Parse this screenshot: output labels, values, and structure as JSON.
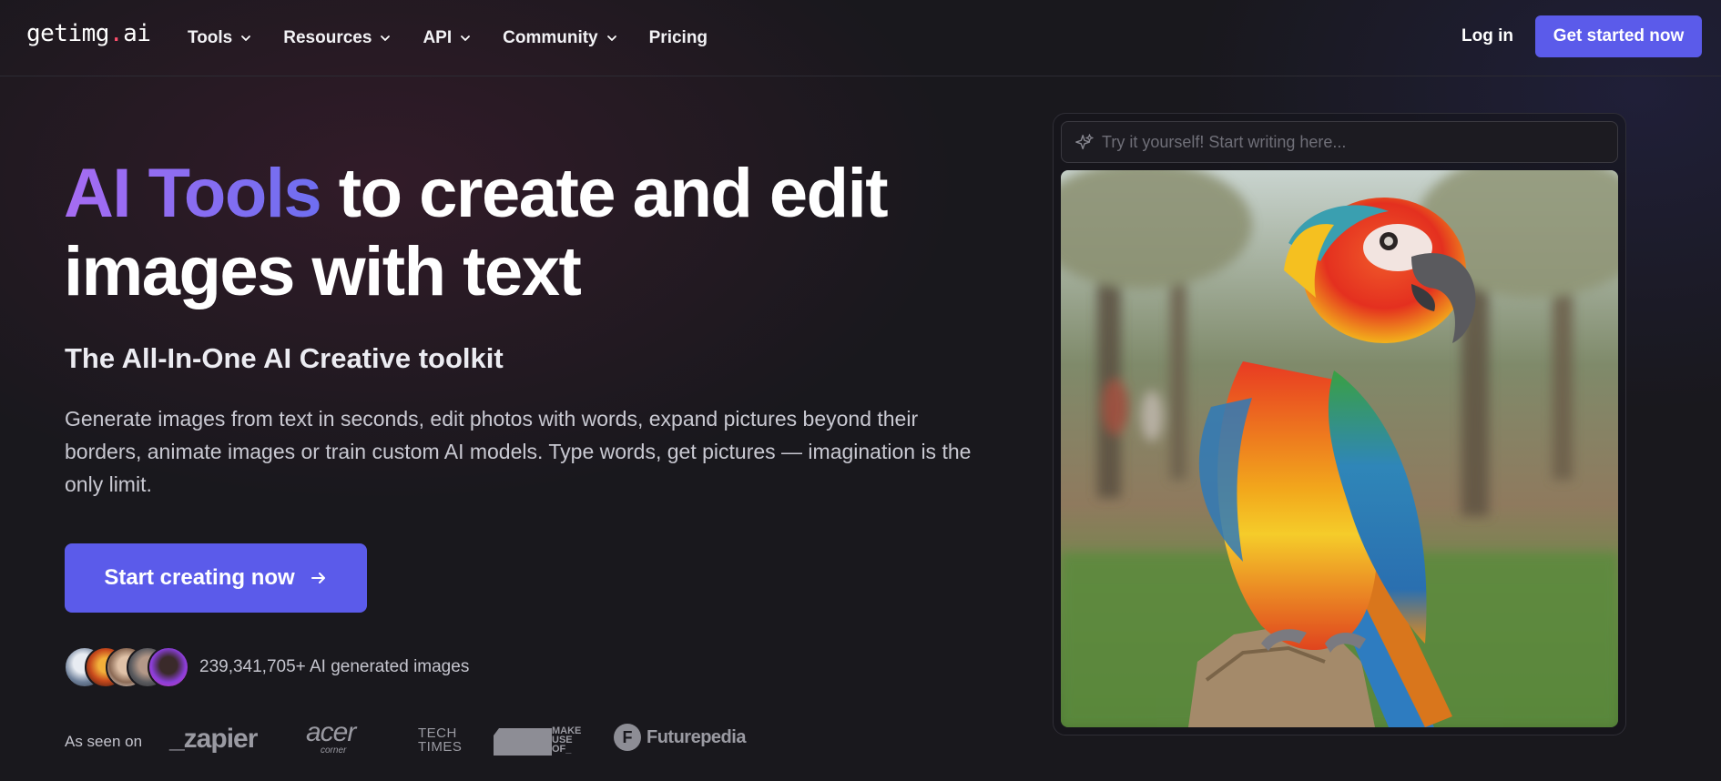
{
  "nav": {
    "logo_part1": "getimg",
    "logo_dot": ".",
    "logo_part2": "ai",
    "items": [
      {
        "label": "Tools"
      },
      {
        "label": "Resources"
      },
      {
        "label": "API"
      },
      {
        "label": "Community"
      },
      {
        "label": "Pricing"
      }
    ],
    "login_label": "Log in",
    "cta_label": "Get started now"
  },
  "hero": {
    "title_highlight": "AI Tools",
    "title_rest": " to create and edit images with text",
    "subtitle": "The All-In-One AI Creative toolkit",
    "description": "Generate images from text in seconds, edit photos with words, expand pictures beyond their borders, animate images or train custom AI models. Type words, get pictures — imagination is the only limit.",
    "cta_label": "Start creating now",
    "generated_count": "239,341,705+ AI generated images"
  },
  "as_seen_on": {
    "label": "As seen on",
    "brands": [
      "_zapier",
      "acer",
      "TECH TIMES",
      "MAKE USE OF",
      "Futurepedia"
    ],
    "acer_tagline": "corner",
    "techtimes_line1": "TECH",
    "techtimes_line2": "TIMES",
    "makeuseof_lines": [
      "MAKE",
      "USE",
      "OF_"
    ],
    "futurepedia_initial": "F"
  },
  "demo": {
    "prompt_placeholder": "Try it yourself! Start writing here...",
    "image_subject": "parrot"
  },
  "colors": {
    "accent": "#5b5bea",
    "gradient_start": "#a66cf2",
    "gradient_end": "#6e6ef0",
    "logo_dot": "#ff4f6d"
  }
}
